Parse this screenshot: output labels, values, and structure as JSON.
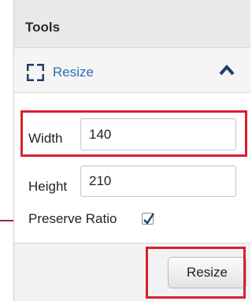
{
  "tools_panel": {
    "title": "Tools",
    "section": {
      "label": "Resize",
      "icon": "resize-corners-icon",
      "toggle_icon": "chevron-up-icon"
    },
    "fields": {
      "width": {
        "label": "Width",
        "value": "140"
      },
      "height": {
        "label": "Height",
        "value": "210"
      },
      "preserve_ratio": {
        "label": "Preserve Ratio",
        "checked": true
      }
    },
    "action_button": {
      "label": "Resize"
    }
  },
  "colors": {
    "highlight": "#d8202f",
    "arrow": "#9b2b3a",
    "link": "#2a6fb7",
    "chevron": "#1f3f66"
  }
}
